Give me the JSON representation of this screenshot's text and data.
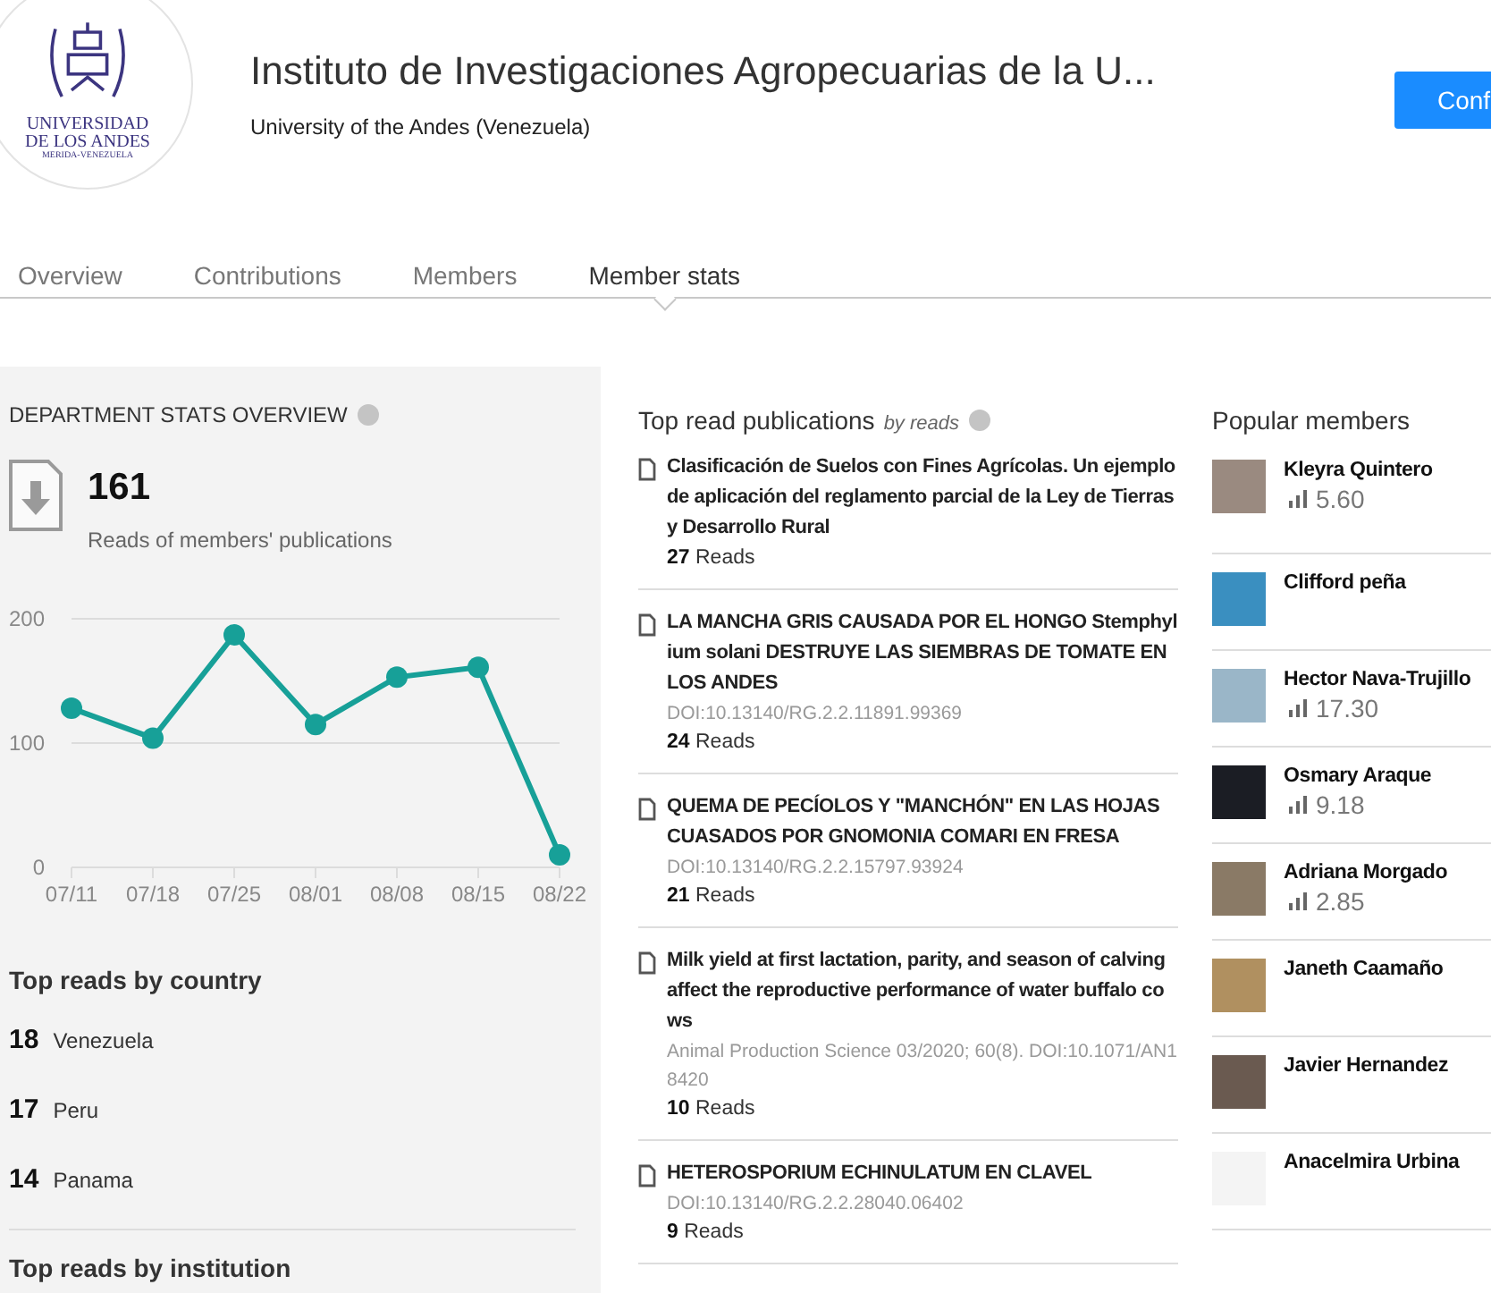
{
  "header": {
    "logo_lines": [
      "UNIVERSIDAD",
      "DE LOS ANDES",
      "MERIDA-VENEZUELA"
    ],
    "title": "Instituto de Investigaciones Agropecuarias de la U...",
    "subtitle": "University of the Andes (Venezuela)",
    "button": "Conf"
  },
  "tabs": [
    {
      "label": "Overview",
      "selected": false
    },
    {
      "label": "Contributions",
      "selected": false
    },
    {
      "label": "Members",
      "selected": false
    },
    {
      "label": "Member stats",
      "selected": true
    }
  ],
  "overview": {
    "heading": "DEPARTMENT STATS OVERVIEW",
    "total": "161",
    "total_label": "Reads of members' publications",
    "chart_data": {
      "type": "line",
      "categories": [
        "07/11",
        "07/18",
        "07/25",
        "08/01",
        "08/08",
        "08/15",
        "08/22"
      ],
      "series": [
        {
          "color": "#17a098",
          "marker": "circle",
          "values": [
            128,
            104,
            187,
            115,
            153,
            161,
            10
          ]
        }
      ],
      "ylim": [
        0,
        200
      ],
      "yticks": [
        0,
        100,
        200
      ]
    }
  },
  "countries": {
    "heading": "Top reads by country",
    "rows": [
      {
        "count": "18",
        "name": "Venezuela"
      },
      {
        "count": "17",
        "name": "Peru"
      },
      {
        "count": "14",
        "name": "Panama"
      }
    ]
  },
  "institutions": {
    "heading": "Top reads by institution"
  },
  "publications": {
    "heading": "Top read publications",
    "qualifier": "by reads",
    "items": [
      {
        "title": "Clasificación de Suelos con Fines Agrícolas. Un ejemplo de aplicación del reglamento parcial de la Ley de Tierras y Desarrollo Rural",
        "reads": "27",
        "reads_label": "Reads"
      },
      {
        "title": "LA MANCHA GRIS CAUSADA POR EL HONGO Stemphylium solani DESTRUYE LAS SIEMBRAS DE TOMATE EN LOS ANDES",
        "meta": "DOI:10.13140/RG.2.2.11891.99369",
        "reads": "24",
        "reads_label": "Reads"
      },
      {
        "title": "QUEMA DE PECÍOLOS Y \"MANCHÓN\" EN LAS HOJAS CUASADOS POR GNOMONIA COMARI EN FRESA",
        "meta": "DOI:10.13140/RG.2.2.15797.93924",
        "reads": "21",
        "reads_label": "Reads"
      },
      {
        "title": "Milk yield at first lactation, parity, and season of calving affect the reproductive performance of water buffalo cows",
        "meta": "Animal Production Science 03/2020; 60(8). DOI:10.1071/AN18420",
        "reads": "10",
        "reads_label": "Reads"
      },
      {
        "title": "HETEROSPORIUM ECHINULATUM EN CLAVEL",
        "meta": "DOI:10.13140/RG.2.2.28040.06402",
        "reads": "9",
        "reads_label": "Reads"
      }
    ]
  },
  "members": {
    "heading": "Popular members",
    "items": [
      {
        "name": "Kleyra Quintero",
        "score": "5.60"
      },
      {
        "name": "Clifford peña"
      },
      {
        "name": "Hector Nava-Trujillo",
        "score": "17.30"
      },
      {
        "name": "Osmary Araque",
        "score": "9.18"
      },
      {
        "name": "Adriana Morgado",
        "score": "2.85"
      },
      {
        "name": "Janeth Caamaño"
      },
      {
        "name": "Javier Hernandez"
      },
      {
        "name": "Anacelmira Urbina"
      }
    ]
  }
}
